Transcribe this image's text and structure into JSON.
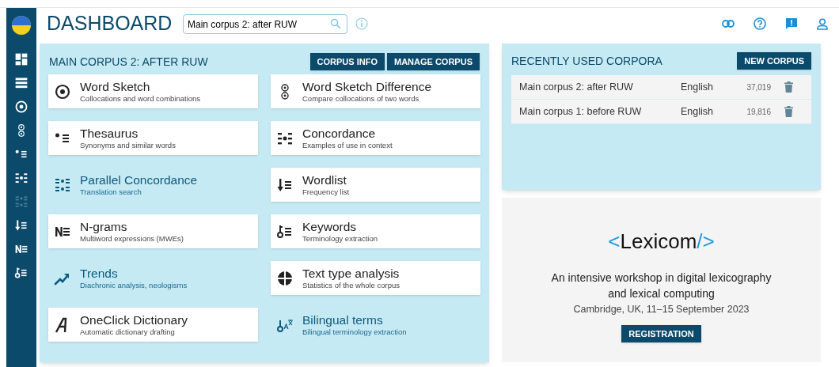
{
  "header": {
    "title": "DASHBOARD",
    "search": {
      "value": "Main corpus 2: after RUW"
    }
  },
  "sidebar": {
    "items": [
      {
        "kind": "dashboard",
        "disabled": false
      },
      {
        "kind": "list",
        "disabled": false
      },
      {
        "kind": "sketch",
        "disabled": false
      },
      {
        "kind": "diff",
        "disabled": false
      },
      {
        "kind": "thesaurus",
        "disabled": false
      },
      {
        "kind": "concordance",
        "disabled": false
      },
      {
        "kind": "parallel",
        "disabled": true
      },
      {
        "kind": "wordlist",
        "disabled": false
      },
      {
        "kind": "ngrams",
        "disabled": false
      },
      {
        "kind": "keywords",
        "disabled": false
      }
    ]
  },
  "corpus_panel": {
    "title": "MAIN CORPUS 2: AFTER RUW",
    "buttons": [
      "CORPUS INFO",
      "MANAGE CORPUS"
    ],
    "tools": [
      {
        "kind": "sketch",
        "name": "Word Sketch",
        "description": "Collocations and word combinations",
        "available": true
      },
      {
        "kind": "diff",
        "name": "Word Sketch Difference",
        "description": "Compare collocations of two words",
        "available": true
      },
      {
        "kind": "thesaurus",
        "name": "Thesaurus",
        "description": "Synonyms and similar words",
        "available": true
      },
      {
        "kind": "concordance",
        "name": "Concordance",
        "description": "Examples of use in context",
        "available": true
      },
      {
        "kind": "parallel",
        "name": "Parallel Concordance",
        "description": "Translation search",
        "available": false
      },
      {
        "kind": "wordlist",
        "name": "Wordlist",
        "description": "Frequency list",
        "available": true
      },
      {
        "kind": "ngrams",
        "name": "N-grams",
        "description": "Multiword expressions (MWEs)",
        "available": true
      },
      {
        "kind": "keywords",
        "name": "Keywords",
        "description": "Terminology extraction",
        "available": true
      },
      {
        "kind": "trends",
        "name": "Trends",
        "description": "Diachronic analysis, neologisms",
        "available": false
      },
      {
        "kind": "texttype",
        "name": "Text type analysis",
        "description": "Statistics of the whole corpus",
        "available": true
      },
      {
        "kind": "oneclick",
        "name": "OneClick Dictionary",
        "description": "Automatic dictionary drafting",
        "available": true
      },
      {
        "kind": "bilingual",
        "name": "Bilingual terms",
        "description": "Bilingual terminology extraction",
        "available": false
      }
    ]
  },
  "recent_panel": {
    "title": "RECENTLY USED CORPORA",
    "button": "NEW CORPUS",
    "rows": [
      {
        "name": "Main corpus 2: after RUW",
        "language": "English",
        "size": "37,019"
      },
      {
        "name": "Main corpus 1: before RUW",
        "language": "English",
        "size": "19,816"
      }
    ]
  },
  "promo": {
    "logo": {
      "open": "<",
      "name": "Lexicom",
      "close": "/>"
    },
    "headline": "An intensive workshop in digital lexicography and lexical computing",
    "details": "Cambridge, UK, 11–15 September 2023",
    "button": "REGISTRATION"
  }
}
